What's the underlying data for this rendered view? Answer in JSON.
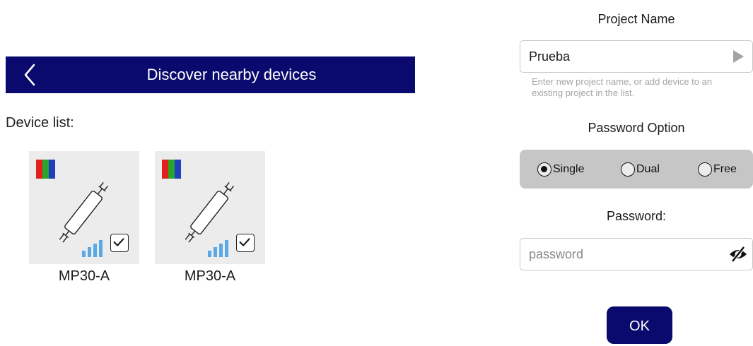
{
  "header": {
    "title": "Discover nearby devices",
    "back_icon": "chevron-left-icon"
  },
  "device_list": {
    "label": "Device list:",
    "devices": [
      {
        "name": "MP30-A",
        "checked": true
      },
      {
        "name": "MP30-A",
        "checked": true
      }
    ]
  },
  "project": {
    "title": "Project Name",
    "value": "Prueba",
    "hint": "Enter new project name, or add device to an existing project in the list."
  },
  "password_option": {
    "title": "Password Option",
    "options": [
      "Single",
      "Dual",
      "Free"
    ],
    "selected": "Single"
  },
  "password": {
    "label": "Password:",
    "placeholder": "password"
  },
  "ok_label": "OK",
  "colors": {
    "accent": "#0a0a6e",
    "rgb": [
      "#e32020",
      "#2aa52a",
      "#1f3fbf"
    ],
    "signal": "#5aa9e6"
  }
}
